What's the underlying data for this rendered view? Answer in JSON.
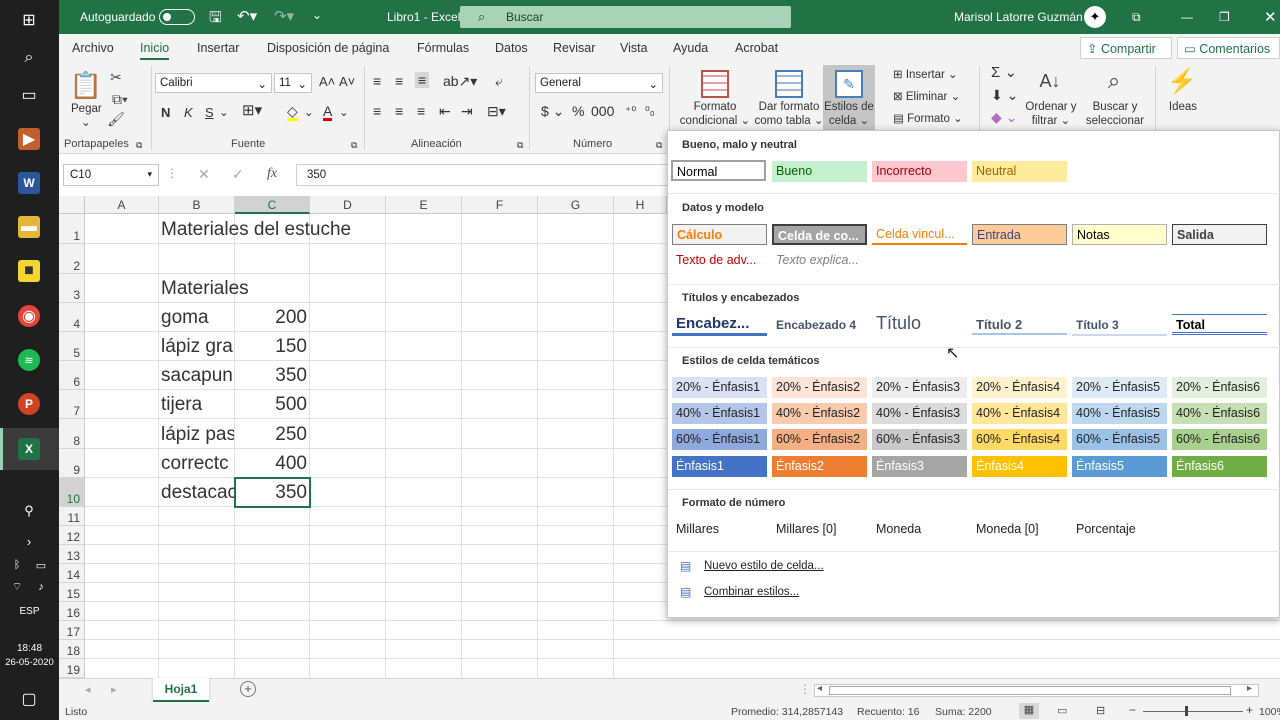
{
  "taskbar": {
    "language": "ESP",
    "time": "18:48",
    "date": "26-05-2020"
  },
  "title": {
    "autosave": "Autoguardado",
    "doc": "Libro1 - Excel",
    "search_placeholder": "Buscar",
    "user": "Marisol Latorre Guzmán"
  },
  "tabs": [
    "Archivo",
    "Inicio",
    "Insertar",
    "Disposición de página",
    "Fórmulas",
    "Datos",
    "Revisar",
    "Vista",
    "Ayuda",
    "Acrobat"
  ],
  "share": "Compartir",
  "comments": "Comentarios",
  "ribbon": {
    "paste": "Pegar",
    "clipboard": "Portapapeles",
    "font_name": "Calibri",
    "font_size": "11",
    "bold": "N",
    "italic": "K",
    "underline": "S",
    "font_group": "Fuente",
    "align_group": "Alineación",
    "number_format": "General",
    "number_group": "Número",
    "cond_format": [
      "Formato",
      "condicional"
    ],
    "format_table": [
      "Dar formato",
      "como tabla"
    ],
    "cell_styles": [
      "Estilos de",
      "celda"
    ],
    "insert": "Insertar",
    "delete": "Eliminar",
    "format": "Formato",
    "sort": [
      "Ordenar y",
      "filtrar"
    ],
    "find": [
      "Buscar y",
      "seleccionar"
    ],
    "ideas": "Ideas"
  },
  "formula_bar": {
    "name_box": "C10",
    "value": "350"
  },
  "columns": [
    "A",
    "B",
    "C",
    "D",
    "E",
    "F",
    "G",
    "H"
  ],
  "rows": [
    "1",
    "2",
    "3",
    "4",
    "5",
    "6",
    "7",
    "8",
    "9",
    "10",
    "11",
    "12",
    "13",
    "14",
    "15",
    "16",
    "17",
    "18",
    "19"
  ],
  "cells": {
    "title": "Materiales del estuche",
    "header": "Materiales",
    "items": [
      {
        "name": "goma",
        "qty": "200"
      },
      {
        "name": "lápiz gra",
        "qty": "150"
      },
      {
        "name": "sacapun",
        "qty": "350"
      },
      {
        "name": "tijera",
        "qty": "500"
      },
      {
        "name": "lápiz pas",
        "qty": "250"
      },
      {
        "name": "correctc",
        "qty": "400"
      },
      {
        "name": "destacac",
        "qty": "350"
      }
    ]
  },
  "gallery": {
    "sec1": "Bueno, malo y neutral",
    "good_bad": [
      "Normal",
      "Bueno",
      "Incorrecto",
      "Neutral"
    ],
    "sec2": "Datos y modelo",
    "data_model_1": [
      "Cálculo",
      "Celda de co...",
      "Celda vincul...",
      "Entrada",
      "Notas",
      "Salida"
    ],
    "data_model_2": [
      "Texto de adv...",
      "Texto explica..."
    ],
    "sec3": "Títulos y encabezados",
    "titles": [
      "Encabez...",
      "Encabezado 4",
      "Título",
      "Título 2",
      "Título 3",
      "Total"
    ],
    "sec4": "Estilos de celda temáticos",
    "row20": [
      "20% - Énfasis1",
      "20% - Énfasis2",
      "20% - Énfasis3",
      "20% - Énfasis4",
      "20% - Énfasis5",
      "20% - Énfasis6"
    ],
    "row40": [
      "40% - Énfasis1",
      "40% - Énfasis2",
      "40% - Énfasis3",
      "40% - Énfasis4",
      "40% - Énfasis5",
      "40% - Énfasis6"
    ],
    "row60": [
      "60% - Énfasis1",
      "60% - Énfasis2",
      "60% - Énfasis3",
      "60% - Énfasis4",
      "60% - Énfasis5",
      "60% - Énfasis6"
    ],
    "row100": [
      "Énfasis1",
      "Énfasis2",
      "Énfasis3",
      "Énfasis4",
      "Énfasis5",
      "Énfasis6"
    ],
    "sec5": "Formato de número",
    "numfmt": [
      "Millares",
      "Millares [0]",
      "Moneda",
      "Moneda [0]",
      "Porcentaje"
    ],
    "new_style": "Nuevo estilo de celda...",
    "merge_styles": "Combinar estilos..."
  },
  "sheet": {
    "tab": "Hoja1"
  },
  "status": {
    "mode": "Listo",
    "average": "Promedio: 314,2857143",
    "count": "Recuento: 16",
    "sum": "Suma: 2200",
    "zoom": "100%"
  },
  "colors": {
    "accent": "#217346"
  }
}
